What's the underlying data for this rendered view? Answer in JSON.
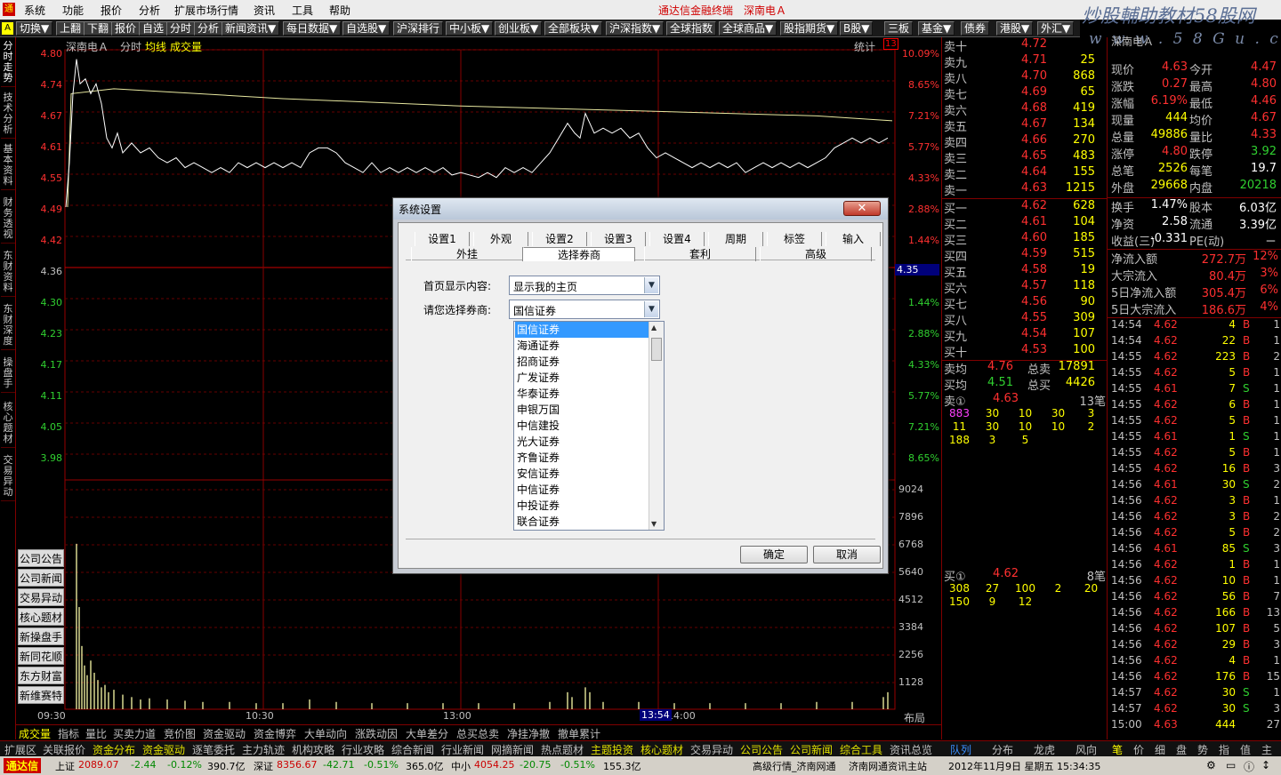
{
  "menubar": {
    "items": [
      "系统",
      "功能",
      "报价",
      "分析",
      "扩展市场行情",
      "资讯",
      "工具",
      "帮助"
    ],
    "brand": "通达信金融终端",
    "stock": "深南电Ａ",
    "watermark": "炒股輔助教材58股网",
    "watermark_url": "w w w . 5 8 G u . c o m"
  },
  "toolbar": {
    "items": [
      "切换▼",
      "上翻",
      "下翻",
      "报价",
      "自选",
      "分时",
      "分析",
      "新闻资讯▼",
      "每日数据▼",
      "自选股▼",
      "沪深排行",
      "中小板▼",
      "创业板▼",
      "全部板块▼",
      "沪深指数▼",
      "全球指数",
      "全球商品▼",
      "股指期货▼",
      "B股▼",
      "三板",
      "基金▼",
      "债券",
      "港股▼",
      "外汇▼"
    ]
  },
  "leftbar": {
    "tabs": [
      "分时走势",
      "技术分析",
      "基本资料",
      "财务透视",
      "东财资料",
      "东财深度",
      "操盘手",
      "核心题材",
      "交易异动"
    ]
  },
  "chart": {
    "stock_name": "深南电Ａ",
    "mode": "分时",
    "avg_label": "均线",
    "vol_label": "成交量",
    "stats_label": "统计",
    "marker": "13",
    "price_labels": [
      "4.80",
      "4.74",
      "4.67",
      "4.61",
      "4.55",
      "4.49",
      "4.42",
      "4.36",
      "4.30",
      "4.23",
      "4.17",
      "4.11",
      "4.05",
      "3.98"
    ],
    "pct_labels": [
      "10.09%",
      "8.65%",
      "7.21%",
      "5.77%",
      "4.33%",
      "2.88%",
      "1.44%",
      "",
      "1.44%",
      "2.88%",
      "4.33%",
      "5.77%",
      "7.21%",
      "8.65%"
    ],
    "vol_labels": [
      "9024",
      "7896",
      "6768",
      "5640",
      "4512",
      "3384",
      "2256",
      "1128"
    ],
    "time_labels": [
      "09:30",
      "10:30",
      "13:00",
      "14:00"
    ],
    "cursor_time": "13:54",
    "cursor_price": "4.35",
    "layout_label": "布局",
    "zoom_in": "+",
    "zoom_out": "−",
    "side_buttons": [
      "公司公告",
      "公司新闻",
      "交易异动",
      "核心题材",
      "新操盘手",
      "新同花顺",
      "东方财富",
      "新维赛特"
    ]
  },
  "chart_data": {
    "type": "line",
    "x": [
      "09:30",
      "10:30",
      "13:00",
      "14:00",
      "15:00"
    ],
    "series": [
      {
        "name": "分时",
        "values": [
          4.49,
          4.61,
          4.55,
          4.63,
          4.62
        ]
      },
      {
        "name": "均线",
        "values": [
          4.49,
          4.72,
          4.7,
          4.69,
          4.67
        ]
      }
    ],
    "ylim": [
      3.98,
      4.8
    ]
  },
  "dialog": {
    "title": "系统设置",
    "close": "✕",
    "tabs_row1": [
      "设置1",
      "外观",
      "设置2",
      "设置3",
      "设置4",
      "周期",
      "标签",
      "输入"
    ],
    "tabs_row2": [
      "外挂",
      "选择券商",
      "套利",
      "高级"
    ],
    "homepage_label": "首页显示内容:",
    "homepage_value": "显示我的主页",
    "broker_label": "请您选择券商:",
    "broker_value": "国信证券",
    "broker_options": [
      "国信证券",
      "海通证券",
      "招商证券",
      "广发证券",
      "华泰证券",
      "申银万国",
      "中信建投",
      "光大证券",
      "齐鲁证券",
      "安信证券",
      "中信证券",
      "中投证券",
      "联合证券"
    ],
    "ok": "确定",
    "cancel": "取消"
  },
  "quote": {
    "sell": [
      {
        "label": "卖十",
        "price": "4.72",
        "vol": ""
      },
      {
        "label": "卖九",
        "price": "4.71",
        "vol": "25"
      },
      {
        "label": "卖八",
        "price": "4.70",
        "vol": "868"
      },
      {
        "label": "卖七",
        "price": "4.69",
        "vol": "65"
      },
      {
        "label": "卖六",
        "price": "4.68",
        "vol": "419"
      },
      {
        "label": "卖五",
        "price": "4.67",
        "vol": "134"
      },
      {
        "label": "卖四",
        "price": "4.66",
        "vol": "270"
      },
      {
        "label": "卖三",
        "price": "4.65",
        "vol": "483"
      },
      {
        "label": "卖二",
        "price": "4.64",
        "vol": "155"
      },
      {
        "label": "卖一",
        "price": "4.63",
        "vol": "1215"
      }
    ],
    "buy": [
      {
        "label": "买一",
        "price": "4.62",
        "vol": "628"
      },
      {
        "label": "买二",
        "price": "4.61",
        "vol": "104"
      },
      {
        "label": "买三",
        "price": "4.60",
        "vol": "185"
      },
      {
        "label": "买四",
        "price": "4.59",
        "vol": "515"
      },
      {
        "label": "买五",
        "price": "4.58",
        "vol": "19"
      },
      {
        "label": "买六",
        "price": "4.57",
        "vol": "118"
      },
      {
        "label": "买七",
        "price": "4.56",
        "vol": "90"
      },
      {
        "label": "买八",
        "price": "4.55",
        "vol": "309"
      },
      {
        "label": "买九",
        "price": "4.54",
        "vol": "107"
      },
      {
        "label": "买十",
        "price": "4.53",
        "vol": "100"
      }
    ],
    "avg_sell_label": "卖均",
    "avg_sell": "4.76",
    "total_sell_label": "总卖",
    "total_sell": "17891",
    "avg_buy_label": "买均",
    "avg_buy": "4.51",
    "total_buy_label": "总买",
    "total_buy": "4426",
    "sell1_label": "卖①",
    "sell1_price": "4.63",
    "sell1_count": "13笔",
    "sell1_queue": [
      [
        "883",
        "30",
        "10",
        "30",
        "3"
      ],
      [
        "11",
        "30",
        "10",
        "10",
        "2"
      ],
      [
        "188",
        "3",
        "5",
        "",
        ""
      ]
    ],
    "buy1_label": "买①",
    "buy1_price": "4.62",
    "buy1_count": "8笔",
    "buy1_queue": [
      [
        "308",
        "27",
        "100",
        "2",
        "20"
      ],
      [
        "150",
        "9",
        "12",
        "",
        ""
      ]
    ],
    "tabs": [
      "队列",
      "分布",
      "龙虎",
      "风向"
    ]
  },
  "info": {
    "header": "深南电Ａ",
    "rows": [
      {
        "l1": "现价",
        "v1": "4.63",
        "l2": "今开",
        "v2": "4.47"
      },
      {
        "l1": "涨跌",
        "v1": "0.27",
        "l2": "最高",
        "v2": "4.80"
      },
      {
        "l1": "涨幅",
        "v1": "6.19%",
        "l2": "最低",
        "v2": "4.46"
      },
      {
        "l1": "现量",
        "v1": "444",
        "l2": "均价",
        "v2": "4.67"
      },
      {
        "l1": "总量",
        "v1": "49886",
        "l2": "量比",
        "v2": "4.33"
      },
      {
        "l1": "涨停",
        "v1": "4.80",
        "l2": "跌停",
        "v2": "3.92"
      },
      {
        "l1": "总笔",
        "v1": "2526",
        "l2": "每笔",
        "v2": "19.7"
      },
      {
        "l1": "外盘",
        "v1": "29668",
        "l2": "内盘",
        "v2": "20218"
      }
    ],
    "rows2": [
      {
        "l1": "换手",
        "v1": "1.47%",
        "l2": "股本",
        "v2": "6.03亿"
      },
      {
        "l1": "净资",
        "v1": "2.58",
        "l2": "流通",
        "v2": "3.39亿"
      },
      {
        "l1": "收益(三)",
        "v1": "-0.331",
        "l2": "PE(动)",
        "v2": "－"
      }
    ],
    "flows": [
      {
        "l": "净流入额",
        "v": "272.7万",
        "p": "12%"
      },
      {
        "l": "大宗流入",
        "v": "80.4万",
        "p": "3%"
      },
      {
        "l": "5日净流入额",
        "v": "305.4万",
        "p": "6%"
      },
      {
        "l": "5日大宗流入",
        "v": "186.6万",
        "p": "4%"
      }
    ],
    "trades": [
      [
        "14:54",
        "4.62",
        "4",
        "B",
        "1"
      ],
      [
        "14:54",
        "4.62",
        "22",
        "B",
        "1"
      ],
      [
        "14:55",
        "4.62",
        "223",
        "B",
        "2"
      ],
      [
        "14:55",
        "4.62",
        "5",
        "B",
        "1"
      ],
      [
        "14:55",
        "4.61",
        "7",
        "S",
        "1"
      ],
      [
        "14:55",
        "4.62",
        "6",
        "B",
        "1"
      ],
      [
        "14:55",
        "4.62",
        "5",
        "B",
        "1"
      ],
      [
        "14:55",
        "4.61",
        "1",
        "S",
        "1"
      ],
      [
        "14:55",
        "4.62",
        "5",
        "B",
        "1"
      ],
      [
        "14:55",
        "4.62",
        "16",
        "B",
        "3"
      ],
      [
        "14:56",
        "4.61",
        "30",
        "S",
        "2"
      ],
      [
        "14:56",
        "4.62",
        "3",
        "B",
        "1"
      ],
      [
        "14:56",
        "4.62",
        "3",
        "B",
        "2"
      ],
      [
        "14:56",
        "4.62",
        "5",
        "B",
        "2"
      ],
      [
        "14:56",
        "4.61",
        "85",
        "S",
        "3"
      ],
      [
        "14:56",
        "4.62",
        "1",
        "B",
        "1"
      ],
      [
        "14:56",
        "4.62",
        "10",
        "B",
        "1"
      ],
      [
        "14:56",
        "4.62",
        "56",
        "B",
        "7"
      ],
      [
        "14:56",
        "4.62",
        "166",
        "B",
        "13"
      ],
      [
        "14:56",
        "4.62",
        "107",
        "B",
        "5"
      ],
      [
        "14:56",
        "4.62",
        "29",
        "B",
        "3"
      ],
      [
        "14:56",
        "4.62",
        "4",
        "B",
        "1"
      ],
      [
        "14:56",
        "4.62",
        "176",
        "B",
        "15"
      ],
      [
        "14:57",
        "4.62",
        "30",
        "S",
        "1"
      ],
      [
        "14:57",
        "4.62",
        "30",
        "S",
        "3"
      ],
      [
        "15:00",
        "4.63",
        "444",
        "",
        "27"
      ]
    ],
    "tabs": [
      "笔",
      "价",
      "细",
      "盘",
      "势",
      "指",
      "值",
      "主"
    ]
  },
  "bottomtabs": [
    "成交量",
    "指标",
    "量比",
    "买卖力道",
    "竞价图",
    "资金驱动",
    "资金博弈",
    "大单动向",
    "涨跌动因",
    "大单差分",
    "总买总卖",
    "净挂净撤",
    "撤单累计"
  ],
  "bottombar": [
    "扩展区",
    "关联报价",
    "资金分布",
    "资金驱动",
    "逐笔委托",
    "主力轨迹",
    "机构攻略",
    "行业攻略",
    "综合新闻",
    "行业新闻",
    "网摘新闻",
    "热点题材",
    "主题投资",
    "核心题材",
    "交易异动",
    "公司公告",
    "公司新闻",
    "综合工具",
    "资讯总览"
  ],
  "statusbar": {
    "app": "通达信",
    "sh_label": "上证",
    "sh": "2089.07",
    "sh_chg": "-2.44",
    "sh_pct": "-0.12%",
    "sh_amt": "390.7亿",
    "sz_label": "深证",
    "sz": "8356.67",
    "sz_chg": "-42.71",
    "sz_pct": "-0.51%",
    "sz_amt": "365.0亿",
    "zx_label": "中小",
    "zx": "4054.25",
    "zx_chg": "-20.75",
    "zx_pct": "-0.51%",
    "zx_amt": "155.3亿",
    "server": "高级行情_济南网通",
    "news": "济南网通资讯主站",
    "datetime": "2012年11月9日  星期五  15:34:35"
  }
}
